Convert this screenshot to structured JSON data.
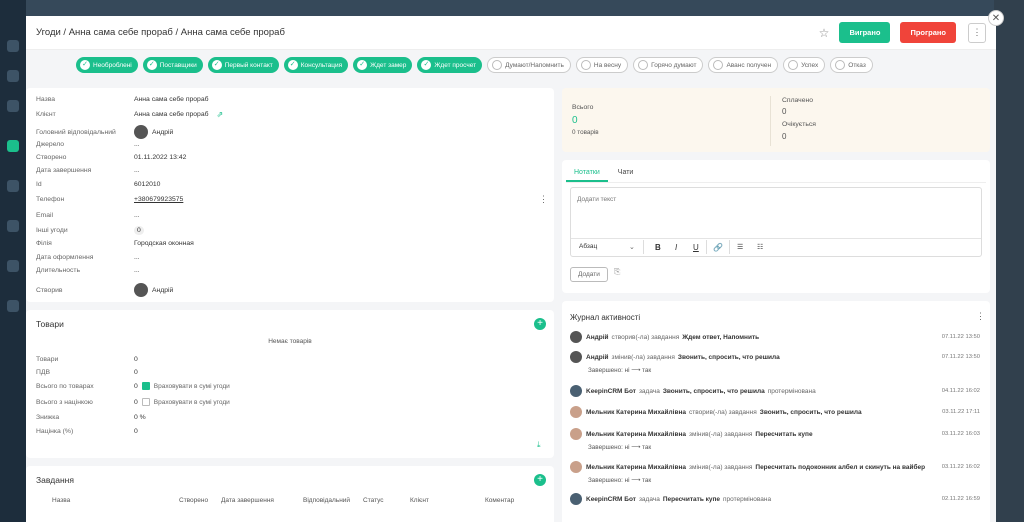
{
  "header": {
    "title": "Угоди / Анна сама себе прораб / Анна сама себе прораб",
    "win_label": "Виграно",
    "lose_label": "Програно",
    "more": "⋮",
    "close": "✕",
    "star": "☆"
  },
  "pipeline": [
    {
      "label": "Необроблені",
      "done": true
    },
    {
      "label": "Поставщики",
      "done": true
    },
    {
      "label": "Первый контакт",
      "done": true
    },
    {
      "label": "Консультация",
      "done": true
    },
    {
      "label": "Ждет замер",
      "done": true
    },
    {
      "label": "Ждет просчет",
      "done": true
    },
    {
      "label": "Думают/Напомнить",
      "done": false
    },
    {
      "label": "На весну",
      "done": false
    },
    {
      "label": "Горячо думают",
      "done": false
    },
    {
      "label": "Аванс получен",
      "done": false
    },
    {
      "label": "Успех",
      "done": false
    },
    {
      "label": "Отказ",
      "done": false
    }
  ],
  "info": {
    "rows": [
      {
        "label": "Назва",
        "value": "Анна сама себе прораб"
      },
      {
        "label": "Клієнт",
        "value": "Анна сама себе прораб"
      },
      {
        "label": "Головний відповідальний",
        "value": "Андрій"
      },
      {
        "label": "Джерело",
        "value": "..."
      },
      {
        "label": "Створено",
        "value": "01.11.2022 13:42"
      },
      {
        "label": "Дата завершення",
        "value": "..."
      },
      {
        "label": "Id",
        "value": "6012010"
      },
      {
        "label": "Телефон",
        "value": "+380679923575"
      },
      {
        "label": "Email",
        "value": "..."
      },
      {
        "label": "Інші угоди",
        "value": "0"
      },
      {
        "label": "Філія",
        "value": "Городская оконная"
      },
      {
        "label": "Дата оформлення",
        "value": "..."
      },
      {
        "label": "Длительность",
        "value": "..."
      },
      {
        "label": "Створив",
        "value": "Андрій"
      }
    ]
  },
  "summary": {
    "total_label": "Всього",
    "total_value": "0",
    "goods_count": "0 товарів",
    "paid_label": "Сплачено",
    "paid_value": "0",
    "expected_label": "Очікується",
    "expected_value": "0"
  },
  "notes": {
    "tab_notes": "Нотатки",
    "tab_chats": "Чати",
    "placeholder": "Додати текст",
    "format_select": "Абзац",
    "bold": "B",
    "italic": "I",
    "underline": "U",
    "add_button": "Додати"
  },
  "goods": {
    "title": "Товари",
    "empty": "Немає товарів",
    "rows": [
      {
        "label": "Товари",
        "value": "0"
      },
      {
        "label": "ПДВ",
        "value": "0"
      },
      {
        "label": "Всього по товарах",
        "value": "0",
        "checkbox": "Враховувати в сумі угоди",
        "checked": true
      },
      {
        "label": "Всього з націнкою",
        "value": "0",
        "checkbox": "Враховувати в сумі угоди",
        "checked": false
      },
      {
        "label": "Знижка",
        "value": "0 %"
      },
      {
        "label": "Націнка (%)",
        "value": "0"
      }
    ]
  },
  "tasks": {
    "title": "Завдання",
    "columns": [
      "Назва",
      "Створено",
      "Дата завершення",
      "Відповідальний",
      "Статус",
      "Клієнт",
      "Коментар"
    ]
  },
  "activity": {
    "title": "Журнал активності",
    "items": [
      {
        "author": "Андрій",
        "action": "створив(-ла) завдання",
        "subject": "Ждем ответ, Напомнить",
        "time": "07.11.22 13:50",
        "sub": "",
        "avatar": "male"
      },
      {
        "author": "Андрій",
        "action": "змінив(-ла) завдання",
        "subject": "Звонить, спросить, что решила",
        "time": "07.11.22 13:50",
        "sub": "Завершено: ні ⟶ так",
        "avatar": "male"
      },
      {
        "author": "KeepinCRM Бот",
        "action": "задача",
        "subject": "Звонить, спросить, что решила",
        "tail": "протермінована",
        "time": "04.11.22 16:02",
        "sub": "",
        "avatar": "bot"
      },
      {
        "author": "Мельник Катерина Михайлівна",
        "action": "створив(-ла) завдання",
        "subject": "Звонить, спросить, что решила",
        "time": "03.11.22 17:11",
        "sub": "",
        "avatar": "female"
      },
      {
        "author": "Мельник Катерина Михайлівна",
        "action": "змінив(-ла) завдання",
        "subject": "Пересчитать купе",
        "time": "03.11.22 16:03",
        "sub": "Завершено: ні ⟶ так",
        "avatar": "female"
      },
      {
        "author": "Мельник Катерина Михайлівна",
        "action": "змінив(-ла) завдання",
        "subject": "Пересчитать подоконник албел и скинуть на вайбер",
        "time": "03.11.22 16:02",
        "sub": "Завершено: ні ⟶ так",
        "avatar": "female"
      },
      {
        "author": "KeepinCRM Бот",
        "action": "задача",
        "subject": "Пересчитать купе",
        "tail": "протермінована",
        "time": "02.11.22 16:59",
        "sub": "",
        "avatar": "bot"
      }
    ]
  }
}
